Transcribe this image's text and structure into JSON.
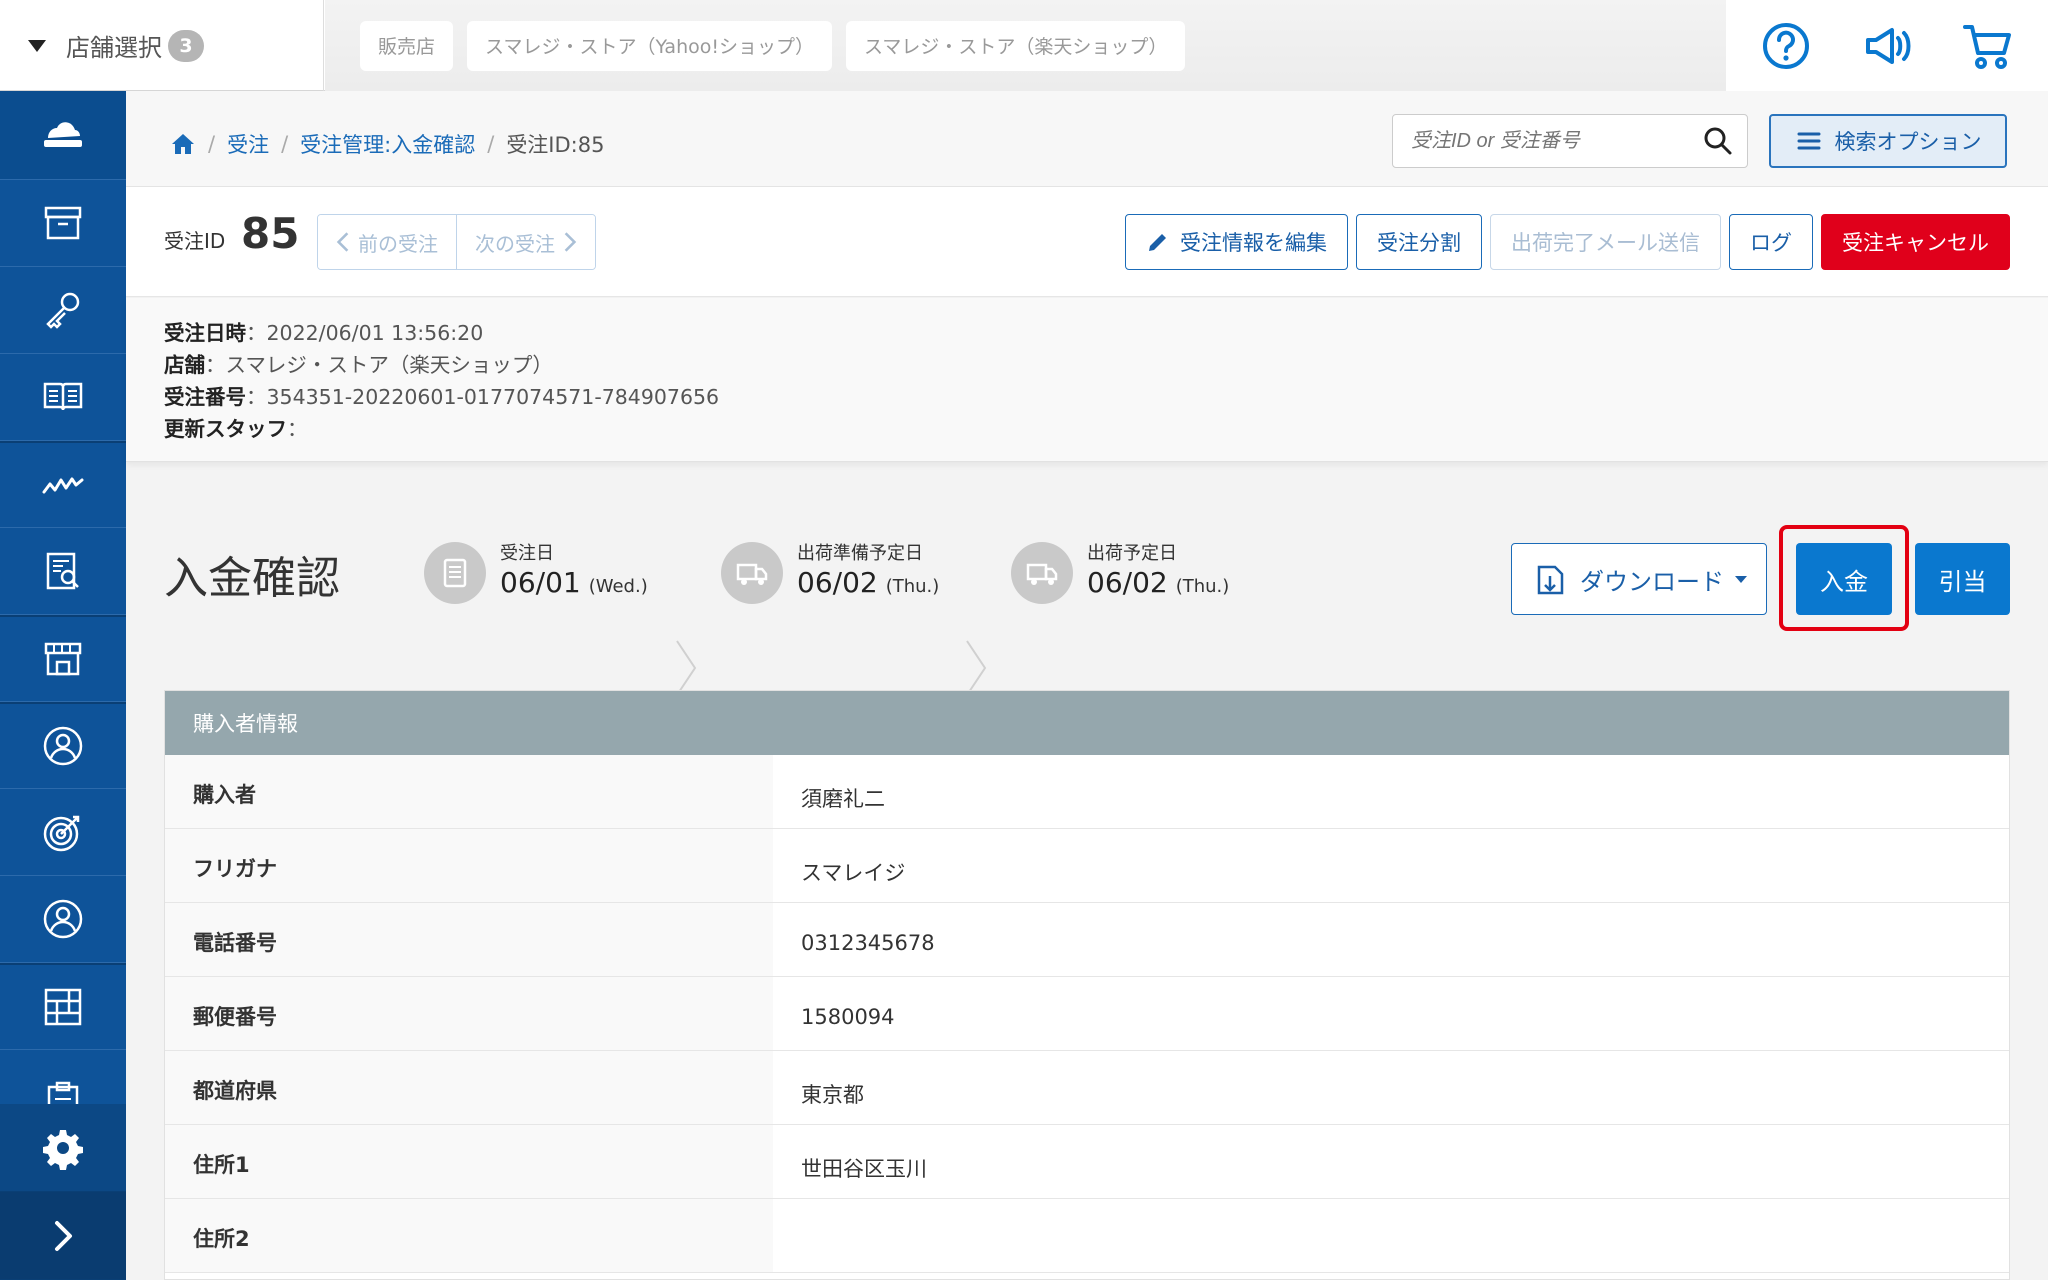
{
  "topbar": {
    "store_select_label": "店舗選択",
    "store_count": "3",
    "store_tabs": [
      "販売店",
      "スマレジ・ストア（Yahoo!ショップ）",
      "スマレジ・ストア（楽天ショップ）"
    ]
  },
  "breadcrumb": {
    "items": [
      "受注",
      "受注管理:入金確認"
    ],
    "current": "受注ID:85"
  },
  "search": {
    "placeholder": "受注ID or 受注番号",
    "options_label": "検索オプション"
  },
  "order": {
    "id_label": "受注ID",
    "id_value": "85",
    "prev_label": "前の受注",
    "next_label": "次の受注",
    "buttons": {
      "edit": "受注情報を編集",
      "split": "受注分割",
      "ship_mail": "出荷完了メール送信",
      "log": "ログ",
      "cancel": "受注キャンセル"
    }
  },
  "meta": {
    "order_date_label": "受注日時",
    "order_date": "2022/06/01 13:56:20",
    "store_label": "店舗",
    "store": "スマレジ・ストア（楽天ショップ）",
    "order_number_label": "受注番号",
    "order_number": "354351-20220601-0177074571-784907656",
    "staff_label": "更新スタッフ",
    "staff": ""
  },
  "status": {
    "title": "入金確認",
    "steps": [
      {
        "label": "受注日",
        "date": "06/01",
        "day": "(Wed.)"
      },
      {
        "label": "出荷準備予定日",
        "date": "06/02",
        "day": "(Thu.)"
      },
      {
        "label": "出荷予定日",
        "date": "06/02",
        "day": "(Thu.)"
      }
    ],
    "download_label": "ダウンロード",
    "pay_label": "入金",
    "allocate_label": "引当"
  },
  "buyer": {
    "header": "購入者情報",
    "rows": [
      {
        "k": "購入者",
        "v": "須磨礼二"
      },
      {
        "k": "フリガナ",
        "v": "スマレイジ"
      },
      {
        "k": "電話番号",
        "v": "0312345678"
      },
      {
        "k": "郵便番号",
        "v": "1580094"
      },
      {
        "k": "都道府県",
        "v": "東京都"
      },
      {
        "k": "住所1",
        "v": "世田谷区玉川"
      },
      {
        "k": "住所2",
        "v": ""
      }
    ]
  },
  "colors": {
    "sidebar": "#0e5399",
    "primary": "#0a78cf",
    "danger": "#e0001b",
    "highlight": "#e30012",
    "panel_header": "#95a7ad"
  }
}
